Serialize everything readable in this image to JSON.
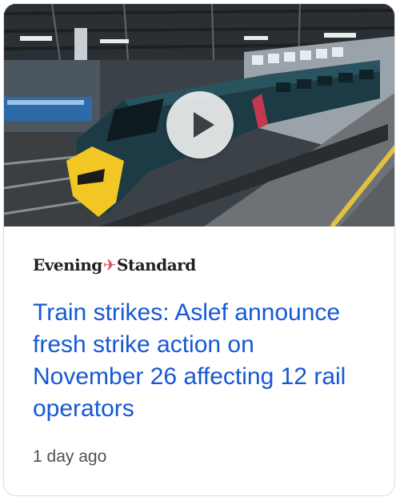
{
  "card": {
    "source_part1": "Evening",
    "source_mark": "✈",
    "source_part2": "Standard",
    "headline": "Train strikes: Aslef announce fresh strike action on November 26 affecting 12 rail operators",
    "timestamp": "1 day ago",
    "thumbnail_icon": "play-icon"
  },
  "colors": {
    "headline": "#1558d6",
    "timestamp": "#4d5156",
    "source_mark": "#d8525f"
  }
}
